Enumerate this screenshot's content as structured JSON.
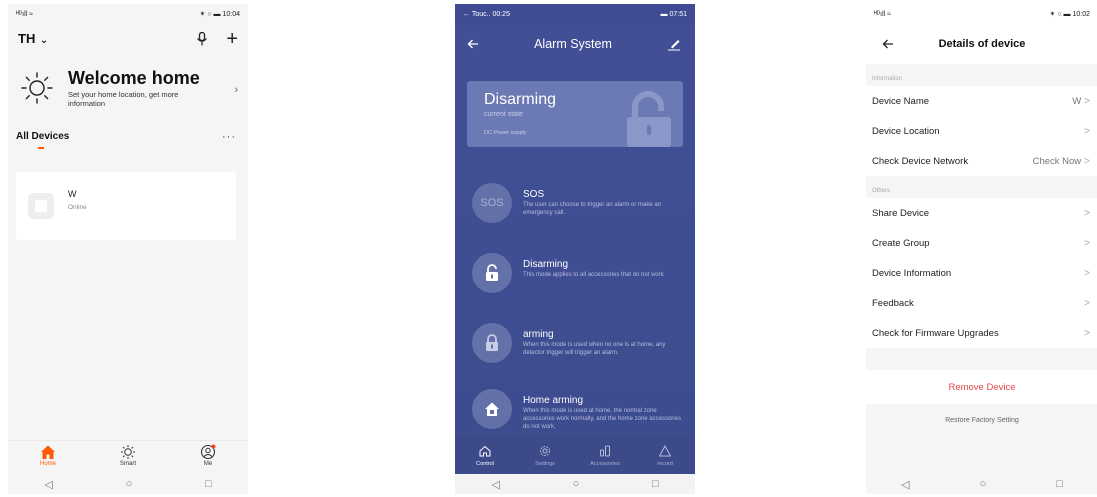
{
  "phone1": {
    "status": {
      "left": "ᴴᴰıll ≈",
      "right": "✶ ○ ▬ 10:04"
    },
    "top": {
      "home_name": "TH",
      "chevron": "⌄",
      "mic": "🎙",
      "plus": "+"
    },
    "welcome": {
      "title": "Welcome home",
      "subtitle": "Set your home location, get more information",
      "chevron": "›"
    },
    "devices": {
      "title": "All Devices",
      "more": "···"
    },
    "device": {
      "name": "W",
      "status": "Online"
    },
    "tabs": [
      {
        "label": "Home",
        "icon": "home-icon"
      },
      {
        "label": "Smart",
        "icon": "sun-icon"
      },
      {
        "label": "Me",
        "icon": "person-icon"
      }
    ],
    "nav": {
      "back": "◁",
      "home": "○",
      "recent": "□"
    },
    "accent": "#ff5a00"
  },
  "phone2": {
    "status": {
      "left": "← Touc.. 00:25",
      "right": "▬ 07:51"
    },
    "title": "Alarm System",
    "state": {
      "title": "Disarming",
      "subtitle": "current state",
      "power": "DC Power supply"
    },
    "modes": [
      {
        "name": "SOS",
        "badge": "SOS",
        "desc": "The user can choose to trigger an alarm or make an emergency call."
      },
      {
        "name": "Disarming",
        "desc": "This mode applies to all accessories that do not work"
      },
      {
        "name": "arming",
        "desc": "When this mode is used when no one is at home, any detector trigger will trigger an alarm."
      },
      {
        "name": "Home arming",
        "desc": "When this mode is used at home, the normal zone accessories work normally, and the home zone accessories do not work,"
      }
    ],
    "tabs": [
      {
        "label": "Control",
        "icon": "home-icon"
      },
      {
        "label": "Settings",
        "icon": "gear-icon"
      },
      {
        "label": "Accessories",
        "icon": "devices-icon"
      },
      {
        "label": "record",
        "icon": "warning-icon"
      }
    ],
    "nav": {
      "back": "◁",
      "home": "○",
      "recent": "□"
    },
    "bg": "#414f95"
  },
  "phone3": {
    "status": {
      "left": "ᴴᴰıll ≈",
      "right": "✶ ○ ▬ 10:02"
    },
    "title": "Details of device",
    "sections": {
      "information": "Information",
      "others": "Others"
    },
    "info_rows": [
      {
        "label": "Device Name",
        "value": "W"
      },
      {
        "label": "Device Location",
        "value": ""
      },
      {
        "label": "Check Device Network",
        "value": "Check Now"
      }
    ],
    "other_rows": [
      {
        "label": "Share Device"
      },
      {
        "label": "Create Group"
      },
      {
        "label": "Device Information"
      },
      {
        "label": "Feedback"
      },
      {
        "label": "Check for Firmware Upgrades"
      }
    ],
    "remove": "Remove Device",
    "restore": "Restore Factory Setting",
    "nav": {
      "back": "◁",
      "home": "○",
      "recent": "□"
    },
    "danger": "#e5484d"
  }
}
